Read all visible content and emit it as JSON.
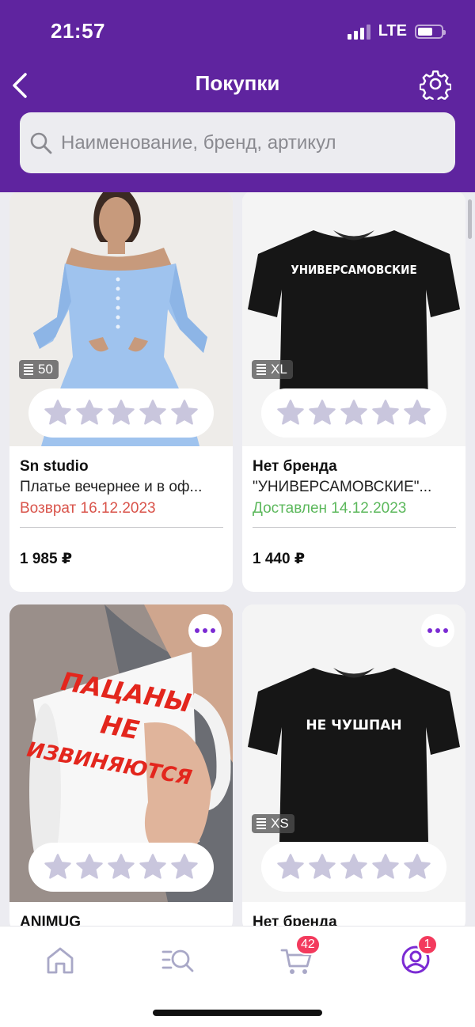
{
  "status_bar": {
    "time": "21:57",
    "network": "LTE"
  },
  "header": {
    "title": "Покупки",
    "back_icon": "chevron-left-icon",
    "settings_icon": "gear-icon"
  },
  "search": {
    "placeholder": "Наименование, бренд, артикул"
  },
  "colors": {
    "brand": "#5f249f",
    "accent": "#7b2bd3",
    "badge": "#f33a5d",
    "returned": "#d9534a",
    "delivered": "#5cb85c",
    "star_empty": "#c9c6dd"
  },
  "products": [
    {
      "brand": "Sn studio",
      "name": "Платье вечернее и в оф...",
      "status": "Возврат 16.12.2023",
      "status_type": "returned",
      "price": "1 985 ₽",
      "size": "50",
      "rating": 0
    },
    {
      "brand": "Нет бренда",
      "name": "\"УНИВЕРСАМОВСКИЕ\"...",
      "status": "Доставлен 14.12.2023",
      "status_type": "delivered",
      "price": "1 440 ₽",
      "size": "XL",
      "print_text": "УНИВЕРСАМОВСКИЕ",
      "rating": 0
    },
    {
      "brand": "ANIMUG",
      "mug_text": [
        "ПАЦАНЫ",
        "НЕ",
        "ИЗВИНЯЮТСЯ"
      ],
      "rating": 0
    },
    {
      "brand": "Нет бренда",
      "size": "XS",
      "print_text": "НЕ ЧУШПАН",
      "rating": 0
    }
  ],
  "tabbar": {
    "items": [
      {
        "icon": "home-icon"
      },
      {
        "icon": "catalog-search-icon"
      },
      {
        "icon": "cart-icon",
        "badge": "42"
      },
      {
        "icon": "profile-icon",
        "badge": "1"
      }
    ]
  }
}
